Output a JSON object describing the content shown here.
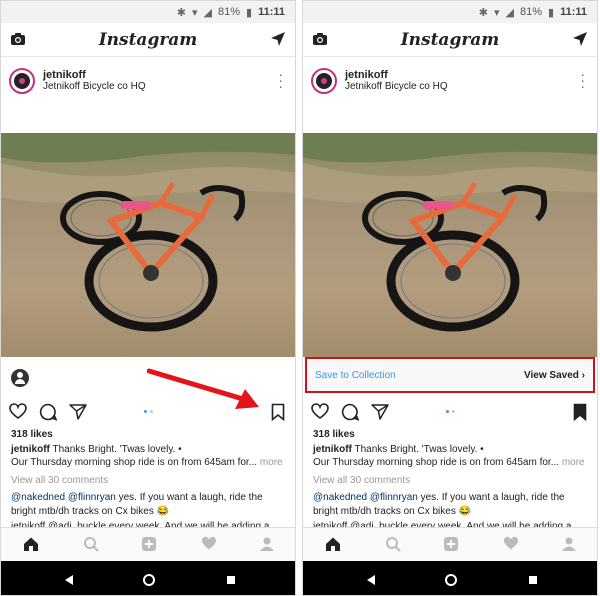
{
  "status": {
    "battery": "81%",
    "time": "11:11"
  },
  "app": {
    "logo": "Instagram"
  },
  "post": {
    "username": "jetnikoff",
    "location": "Jetnikoff Bicycle co HQ",
    "likes": "318 likes",
    "caption_user": "jetnikoff",
    "caption_text": "Thanks Bright. 'Twas lovely. •",
    "caption_line2": "Our Thursday morning shop ride is on from 645am for...",
    "caption_more": "more",
    "view_comments": "View all 30 comments",
    "reply_mention1": "@nakedned",
    "reply_mention2": "@flinnryan",
    "reply_text": "yes. If you want a laugh, ride the bright mtb/dh tracks on Cx bikes 😂",
    "reply_cut": "jetnikoff @adi_buckle every week. And we will be adding a"
  },
  "save_bar": {
    "collection_label": "Save to Collection",
    "view_saved_label": "View Saved ›"
  },
  "colors": {
    "accent_link": "#3897f0",
    "highlight_border": "#d0111c",
    "arrow": "#e3151a",
    "avatar_ring": "#c6307a"
  },
  "icons": {
    "camera": "camera-icon",
    "direct": "paper-plane-icon",
    "like": "heart-outline-icon",
    "comment": "comment-bubble-icon",
    "share": "paper-plane-icon",
    "bookmark": "bookmark-icon",
    "home": "home-icon",
    "search": "search-icon",
    "add": "plus-square-icon",
    "activity": "heart-icon",
    "profile": "person-icon"
  }
}
